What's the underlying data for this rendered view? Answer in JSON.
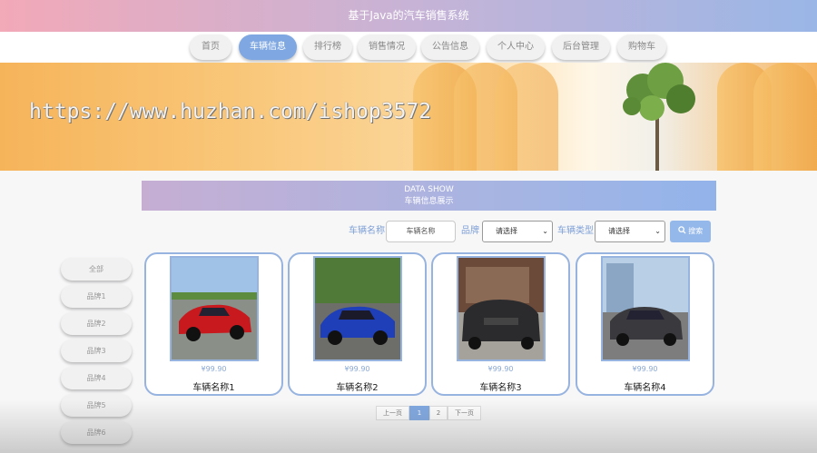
{
  "header": {
    "title": "基于Java的汽车销售系统"
  },
  "nav": [
    {
      "label": "首页",
      "active": false
    },
    {
      "label": "车辆信息",
      "active": true
    },
    {
      "label": "排行榜",
      "active": false
    },
    {
      "label": "销售情况",
      "active": false
    },
    {
      "label": "公告信息",
      "active": false
    },
    {
      "label": "个人中心",
      "active": false
    },
    {
      "label": "后台管理",
      "active": false
    },
    {
      "label": "购物车",
      "active": false
    }
  ],
  "banner": {
    "watermark": "https://www.huzhan.com/ishop3572"
  },
  "section": {
    "title_en": "DATA SHOW",
    "title_cn": "车辆信息展示"
  },
  "search": {
    "name_label": "车辆名称",
    "name_placeholder": "车辆名称",
    "brand_label": "品牌",
    "brand_value": "请选择",
    "type_label": "车辆类型",
    "type_value": "请选择",
    "button_label": "搜索"
  },
  "brands": [
    "全部",
    "品牌1",
    "品牌2",
    "品牌3",
    "品牌4",
    "品牌5",
    "品牌6"
  ],
  "cars": [
    {
      "price": "¥99.90",
      "name": "车辆名称1",
      "color": "#c8191e"
    },
    {
      "price": "¥99.90",
      "name": "车辆名称2",
      "color": "#1f3fb8"
    },
    {
      "price": "¥99.90",
      "name": "车辆名称3",
      "color": "#2b2b2e"
    },
    {
      "price": "¥99.90",
      "name": "车辆名称4",
      "color": "#3a3a3e"
    }
  ],
  "pagination": {
    "prev": "上一页",
    "pages": [
      "1",
      "2"
    ],
    "current": "1",
    "next": "下一页"
  }
}
